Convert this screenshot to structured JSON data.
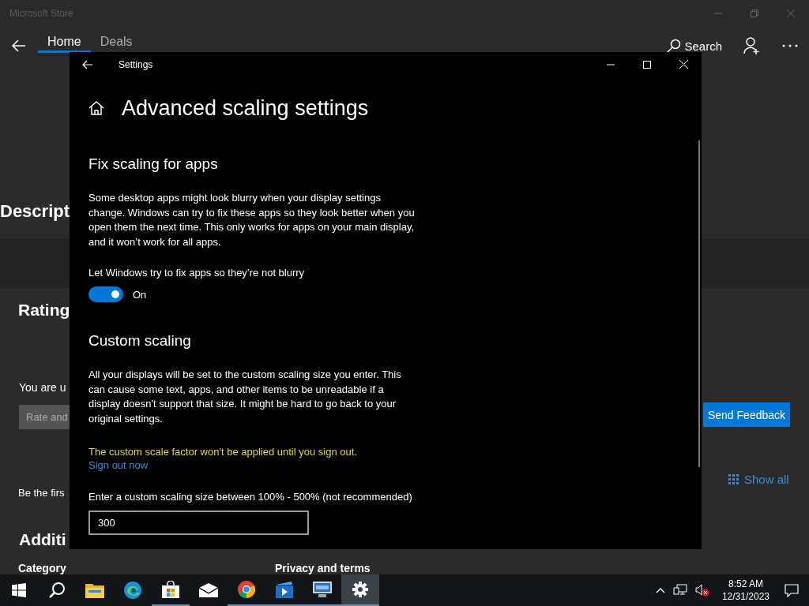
{
  "store": {
    "title": "Microsoft Store",
    "tabs": [
      {
        "label": "Home",
        "selected": true
      },
      {
        "label": "Deals",
        "selected": false
      }
    ],
    "search": "Search",
    "description_heading": "Descript",
    "ratings_heading": "Rating",
    "rating_prompt": "You are u",
    "rate_button": "Rate and",
    "first_review": "Be the firs",
    "additional_heading": "Additi",
    "category_label": "Category",
    "privacy_label": "Privacy and terms",
    "feedback_button": "Send Feedback",
    "show_all": "Show all"
  },
  "settings": {
    "window_title": "Settings",
    "page_title": "Advanced scaling settings",
    "fix_section": {
      "heading": "Fix scaling for apps",
      "description": "Some desktop apps might look blurry when your display settings change. Windows can try to fix these apps so they look better when you open them the next time. This only works for apps on your main display, and it won’t work for all apps.",
      "toggle_label": "Let Windows try to fix apps so they’re not blurry",
      "toggle": {
        "on": true,
        "state_text": "On"
      }
    },
    "custom_section": {
      "heading": "Custom scaling",
      "description": "All your displays will be set to the custom scaling size you enter. This can cause some text, apps, and other items to be unreadable if a display doesn't support that size. It might be hard to go back to your original settings.",
      "warning": "The custom scale factor won't be applied until you sign out.",
      "link": "Sign out now",
      "field_label": "Enter a custom scaling size between 100% - 500% (not recommended)",
      "field_value": "300"
    }
  },
  "taskbar": {
    "apps": [
      {
        "kind": "start",
        "running": false,
        "selected": false
      },
      {
        "kind": "search",
        "running": false,
        "selected": false
      },
      {
        "kind": "folder",
        "running": false,
        "selected": false
      },
      {
        "kind": "edge",
        "running": false,
        "selected": false
      },
      {
        "kind": "store",
        "running": true,
        "selected": false
      },
      {
        "kind": "mail",
        "running": false,
        "selected": false
      },
      {
        "kind": "chrome",
        "running": true,
        "selected": false
      },
      {
        "kind": "movie",
        "running": true,
        "selected": false
      },
      {
        "kind": "monitor",
        "running": true,
        "selected": false
      },
      {
        "kind": "gear",
        "running": true,
        "selected": true
      }
    ],
    "time": "8:52 AM",
    "date": "12/31/2023"
  }
}
